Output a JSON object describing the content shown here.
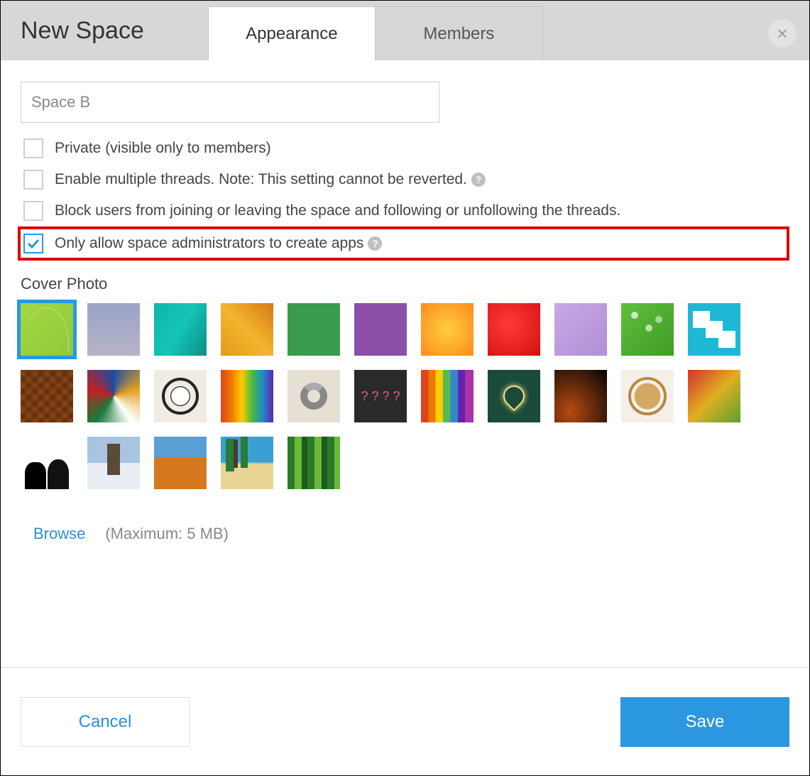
{
  "header": {
    "title": "New Space",
    "tabs": {
      "appearance": "Appearance",
      "members": "Members"
    }
  },
  "form": {
    "space_name": "Space B",
    "options": {
      "private": "Private (visible only to members)",
      "multithread": "Enable multiple threads. Note: This setting cannot be reverted.",
      "block_join": "Block users from joining or leaving the space and following or unfollowing the threads.",
      "admin_apps": "Only allow space administrators to create apps"
    },
    "cover_label": "Cover Photo",
    "browse": "Browse",
    "max_hint": "(Maximum: 5 MB)"
  },
  "footer": {
    "cancel": "Cancel",
    "save": "Save"
  }
}
